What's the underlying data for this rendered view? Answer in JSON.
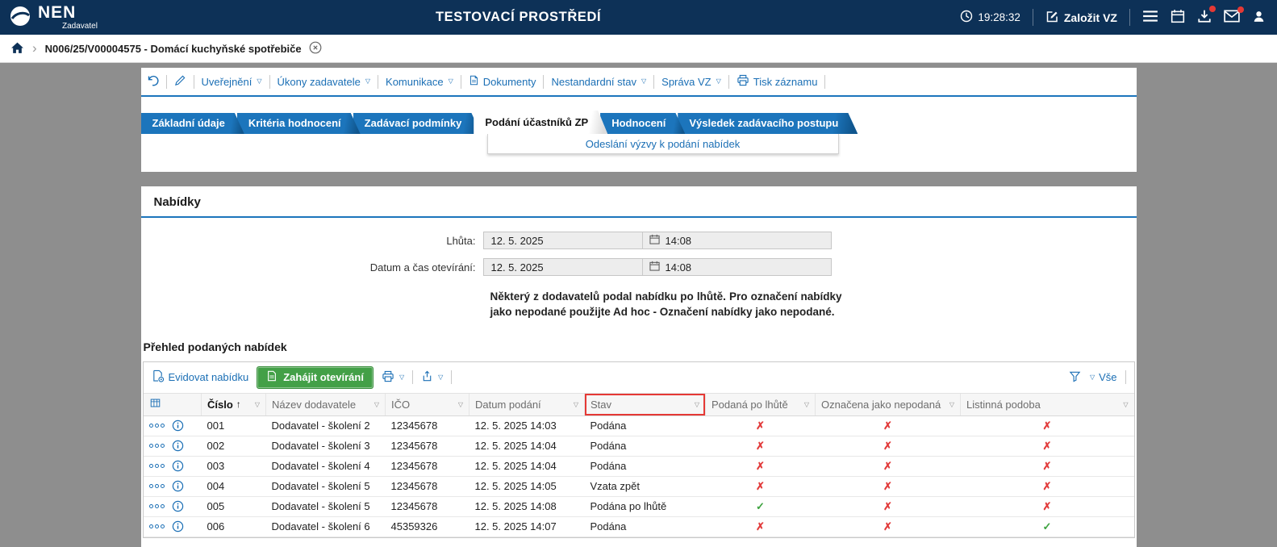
{
  "header": {
    "logo": "NEN",
    "logo_sub": "Zadavatel",
    "env_title": "TESTOVACÍ PROSTŘEDÍ",
    "time": "19:28:32",
    "create_vz": "Založit VZ"
  },
  "breadcrumb": {
    "label": "N006/25/V00004575 - Domácí kuchyňské spotřebiče"
  },
  "toolbar": {
    "uverejneni": "Uveřejnění",
    "ukony_zadavatele": "Úkony zadavatele",
    "komunikace": "Komunikace",
    "dokumenty": "Dokumenty",
    "nestandardni_stav": "Nestandardní stav",
    "sprava_vz": "Správa VZ",
    "tisk_zaznamu": "Tisk záznamu"
  },
  "tabs": [
    {
      "label": "Základní údaje",
      "active": false
    },
    {
      "label": "Kritéria hodnocení",
      "active": false
    },
    {
      "label": "Zadávací podmínky",
      "active": false
    },
    {
      "label": "Podání účastníků ZP",
      "active": true
    },
    {
      "label": "Hodnocení",
      "active": false
    },
    {
      "label": "Výsledek zadávacího postupu",
      "active": false
    }
  ],
  "tab_panel_link": "Odeslání výzvy k podání nabídek",
  "nabidky": {
    "title": "Nabídky",
    "lhuta_label": "Lhůta:",
    "lhuta_date": "12. 5. 2025",
    "lhuta_time": "14:08",
    "otevirani_label": "Datum a čas otevírání:",
    "otevirani_date": "12. 5. 2025",
    "otevirani_time": "14:08",
    "warning": "Některý z dodavatelů podal nabídku po lhůtě. Pro označení nabídky jako nepodané použijte Ad hoc - Označení nabídky jako nepodané."
  },
  "prehled": {
    "title": "Přehled podaných nabídek",
    "evidovat": "Evidovat nabídku",
    "zahajit": "Zahájit otevírání",
    "vse": "Vše"
  },
  "table": {
    "columns": [
      "Číslo",
      "Název dodavatele",
      "IČO",
      "Datum podání",
      "Stav",
      "Podaná po lhůtě",
      "Označena jako nepodaná",
      "Listinná podoba"
    ],
    "rows": [
      {
        "cislo": "001",
        "dodavatel": "Dodavatel - školení 2",
        "ico": "12345678",
        "datum": "12. 5. 2025 14:03",
        "stav": "Podána",
        "po_lhute": "no",
        "nepodana": "no",
        "listinna": "no"
      },
      {
        "cislo": "002",
        "dodavatel": "Dodavatel - školení 3",
        "ico": "12345678",
        "datum": "12. 5. 2025 14:04",
        "stav": "Podána",
        "po_lhute": "no",
        "nepodana": "no",
        "listinna": "no"
      },
      {
        "cislo": "003",
        "dodavatel": "Dodavatel - školení 4",
        "ico": "12345678",
        "datum": "12. 5. 2025 14:04",
        "stav": "Podána",
        "po_lhute": "no",
        "nepodana": "no",
        "listinna": "no"
      },
      {
        "cislo": "004",
        "dodavatel": "Dodavatel - školení 5",
        "ico": "12345678",
        "datum": "12. 5. 2025 14:05",
        "stav": "Vzata zpět",
        "po_lhute": "no",
        "nepodana": "no",
        "listinna": "no"
      },
      {
        "cislo": "005",
        "dodavatel": "Dodavatel - školení 5",
        "ico": "12345678",
        "datum": "12. 5. 2025 14:08",
        "stav": "Podána po lhůtě",
        "po_lhute": "yes",
        "nepodana": "no",
        "listinna": "no"
      },
      {
        "cislo": "006",
        "dodavatel": "Dodavatel - školení 6",
        "ico": "45359326",
        "datum": "12. 5. 2025 14:07",
        "stav": "Podána",
        "po_lhute": "no",
        "nepodana": "no",
        "listinna": "yes"
      }
    ]
  },
  "glyphs": {
    "check": "✓",
    "cross": "✗",
    "dropdown": "▽",
    "sort_asc": "↑",
    "breadcrumb_chevron": "›"
  },
  "colors": {
    "header_bg": "#0d3157",
    "accent_blue": "#1b6fb5",
    "tab_blue": "#1c75bc",
    "green": "#43a047",
    "red": "#e23b3b"
  }
}
